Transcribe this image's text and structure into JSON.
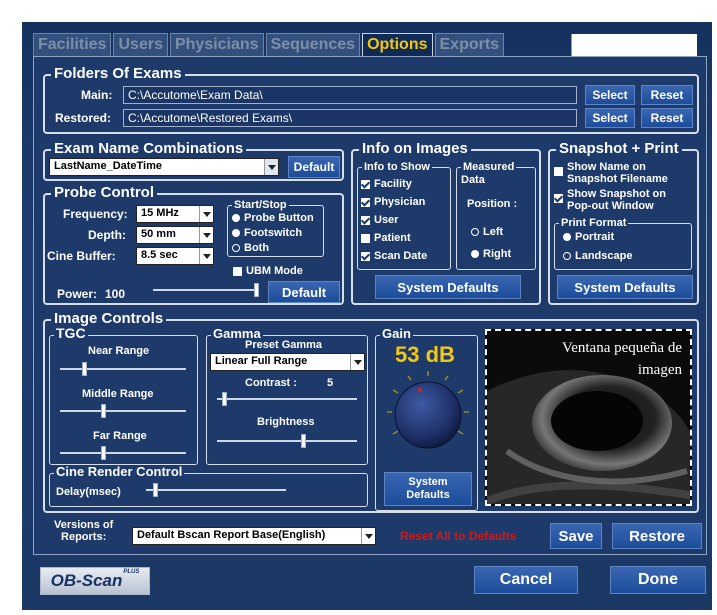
{
  "tabs": [
    "Facilities",
    "Users",
    "Physicians",
    "Sequences",
    "Options",
    "Exports"
  ],
  "active_tab": "Options",
  "folders": {
    "title": "Folders Of Exams",
    "main_label": "Main:",
    "main_value": "C:\\Accutome\\Exam Data\\",
    "restored_label": "Restored:",
    "restored_value": "C:\\Accutome\\Restored Exams\\",
    "select": "Select",
    "reset": "Reset"
  },
  "exam_name": {
    "title": "Exam Name Combinations",
    "selected": "LastName_DateTime",
    "default": "Default"
  },
  "probe": {
    "title": "Probe Control",
    "frequency_label": "Frequency:",
    "frequency_value": "15 MHz",
    "depth_label": "Depth:",
    "depth_value": "50 mm",
    "cine_label": "Cine Buffer:",
    "cine_value": "8.5 sec",
    "startstop_title": "Start/Stop",
    "opt_probe": "Probe Button",
    "opt_foot": "Footswitch",
    "opt_both": "Both",
    "ubm": "UBM Mode",
    "power_label": "Power:",
    "power_value": "100",
    "power_level": 1.0,
    "default": "Default"
  },
  "info": {
    "title": "Info on Images",
    "show_title": "Info to Show",
    "facility": "Facility",
    "physician": "Physician",
    "user": "User",
    "patient": "Patient",
    "scan_date": "Scan Date",
    "measured_title": "Measured",
    "measured_sub": "Data",
    "position": "Position :",
    "left": "Left",
    "right": "Right",
    "system_defaults": "System Defaults"
  },
  "snapshot": {
    "title": "Snapshot + Print",
    "show_name_1": "Show Name on",
    "show_name_2": "Snapshot Filename",
    "show_popout_1": "Show Snapshot on",
    "show_popout_2": "Pop-out Window",
    "print_format": "Print Format",
    "portrait": "Portrait",
    "landscape": "Landscape",
    "system_defaults": "System Defaults"
  },
  "image_controls": {
    "title": "Image Controls",
    "tgc_title": "TGC",
    "near": "Near Range",
    "middle": "Middle Range",
    "far": "Far Range",
    "near_level": 0.18,
    "middle_level": 0.34,
    "far_level": 0.34,
    "gamma_title": "Gamma",
    "preset": "Preset Gamma",
    "preset_value": "Linear Full Range",
    "contrast_label": "Contrast :",
    "contrast_value": "5",
    "contrast_level": 0.04,
    "brightness": "Brightness",
    "brightness_level": 0.62,
    "gain_title": "Gain",
    "gain_value": "53 dB",
    "system_defaults_1": "System",
    "system_defaults_2": "Defaults",
    "preview_caption_1": "Ventana pequeña de",
    "preview_caption_2": "imagen"
  },
  "cine_render": {
    "title": "Cine Render Control",
    "delay_label": "Delay(msec)",
    "delay_level": 0.05
  },
  "footer": {
    "versions_1": "Versions of",
    "versions_2": "Reports:",
    "report_value": "Default Bscan Report Base(English)",
    "reset_all": "Reset All to Defaults",
    "save": "Save",
    "restore": "Restore",
    "logo": "OB-Scan",
    "logo_plus": "PLUS",
    "cancel": "Cancel",
    "done": "Done"
  },
  "colors": {
    "background": "#1d3a6b",
    "accent": "#f3c713",
    "button": "#1c4d9a",
    "warning": "#cc1b1b"
  }
}
